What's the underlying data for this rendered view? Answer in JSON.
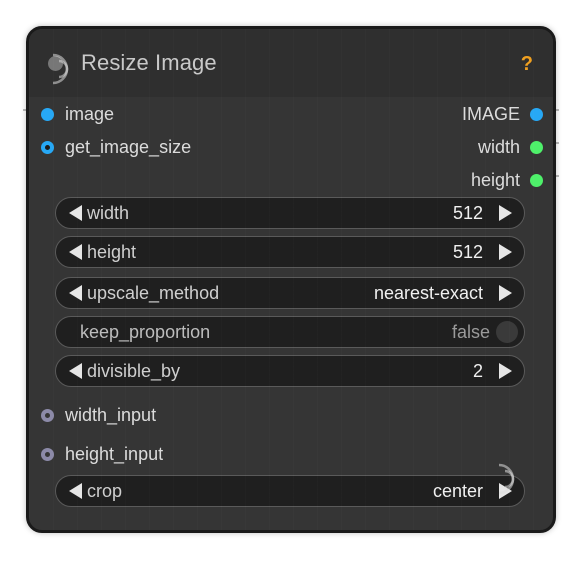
{
  "node": {
    "title": "Resize Image",
    "help_label": "?"
  },
  "inputs": [
    {
      "label": "image",
      "color": "#27a8f5"
    },
    {
      "label": "get_image_size",
      "color": "#27a8f5"
    }
  ],
  "outputs": [
    {
      "label": "IMAGE",
      "color": "#27a8f5"
    },
    {
      "label": "width",
      "color": "#4ef06a"
    },
    {
      "label": "height",
      "color": "#4ef06a"
    }
  ],
  "widgets": {
    "width": {
      "label": "width",
      "value": "512"
    },
    "height": {
      "label": "height",
      "value": "512"
    },
    "upscale_method": {
      "label": "upscale_method",
      "value": "nearest-exact"
    },
    "keep_proportion": {
      "label": "keep_proportion",
      "value": "false"
    },
    "divisible_by": {
      "label": "divisible_by",
      "value": "2"
    },
    "crop": {
      "label": "crop",
      "value": "center"
    }
  },
  "optional_inputs": [
    {
      "label": "width_input",
      "color": "#8c8aa8"
    },
    {
      "label": "height_input",
      "color": "#8c8aa8"
    }
  ]
}
